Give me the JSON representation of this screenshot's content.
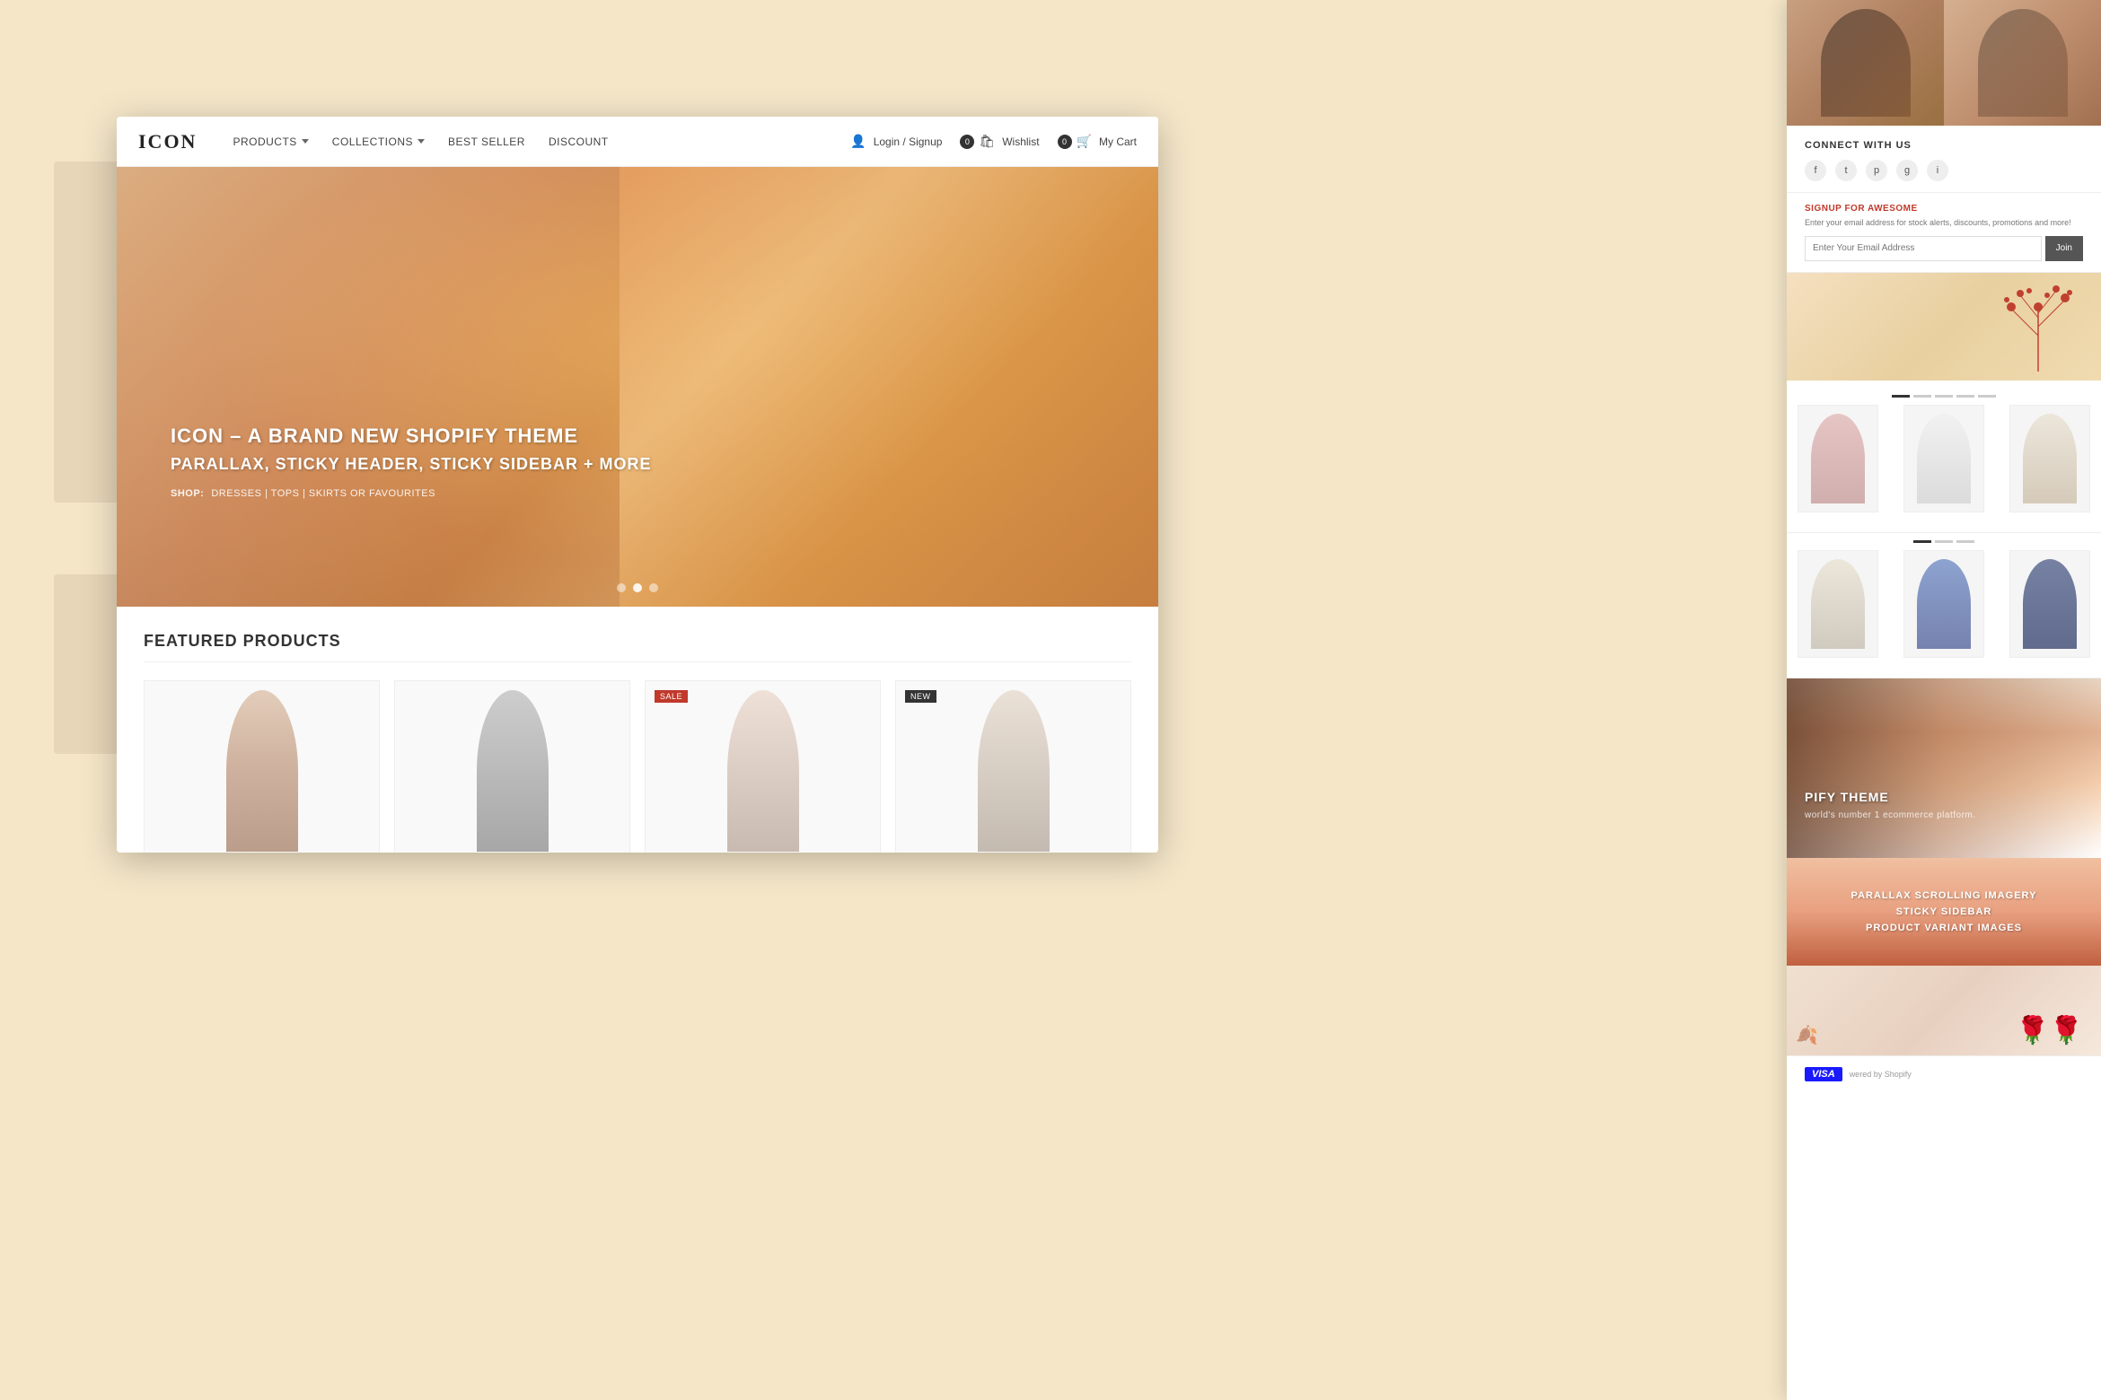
{
  "background": {
    "color": "#f5e6c8"
  },
  "navbar": {
    "logo": "ICON",
    "links": [
      {
        "label": "PRODUCTS",
        "has_dropdown": true,
        "id": "products"
      },
      {
        "label": "COLLECTIONS",
        "has_dropdown": true,
        "id": "collections"
      },
      {
        "label": "BEST SELLER",
        "has_dropdown": false,
        "id": "best-seller"
      },
      {
        "label": "DISCOUNT",
        "has_dropdown": false,
        "id": "discount"
      }
    ],
    "actions": [
      {
        "label": "Login / Signup",
        "type": "account",
        "id": "login"
      },
      {
        "label": "Wishlist",
        "badge": "0",
        "type": "wishlist",
        "id": "wishlist"
      },
      {
        "label": "My Cart",
        "badge": "0",
        "type": "cart",
        "id": "cart"
      }
    ]
  },
  "hero": {
    "title": "ICON – A BRAND NEW SHOPIFY THEME",
    "subtitle": "PARALLAX, STICKY HEADER, STICKY SIDEBAR + MORE",
    "shop_label": "SHOP:",
    "shop_links": "DRESSES | TOPS | SKIRTS OR  FAVOURITES",
    "dots": [
      {
        "active": false
      },
      {
        "active": true
      },
      {
        "active": false
      }
    ]
  },
  "featured_section": {
    "title": "FEATURED PRODUCTS",
    "divider_color": "#eee",
    "products": [
      {
        "badge": null,
        "color": "neutral"
      },
      {
        "badge": null,
        "color": "gray"
      },
      {
        "badge": "SALE",
        "color": "pink"
      },
      {
        "badge": "NEW",
        "color": "cream"
      }
    ]
  },
  "right_panel": {
    "connect": {
      "title": "CONNECT WITH US",
      "social": [
        "f",
        "t",
        "p",
        "g",
        "i"
      ]
    },
    "signup": {
      "title": "SIGNUP FOR AWESOME",
      "description": "Enter your email address for stock alerts, discounts, promotions and more!",
      "input_placeholder": "Enter Your Email Address",
      "button_label": "Join"
    },
    "products_row1": {
      "dots": [
        {
          "active": true
        },
        {
          "active": false
        },
        {
          "active": false
        },
        {
          "active": false
        },
        {
          "active": false
        }
      ],
      "items": [
        {
          "color": "pink"
        },
        {
          "color": "white"
        },
        {
          "color": "cream2"
        }
      ]
    },
    "products_row2": {
      "dots": [
        {
          "active": true
        },
        {
          "active": false
        },
        {
          "active": false
        }
      ],
      "items": [
        {
          "color": "sp-white"
        },
        {
          "color": "navy"
        },
        {
          "color": "dark-blue"
        }
      ]
    },
    "dark_section": {
      "main_text": "PIFY THEME",
      "sub_text": "world's number 1 ecommerce platform.",
      "features": [
        "PARALLAX SCROLLING IMAGERY",
        "STICKY SIDEBAR",
        "PRODUCT VARIANT IMAGES"
      ]
    },
    "payment": {
      "label": "wered by Shopify",
      "visa_label": "VISA"
    }
  }
}
